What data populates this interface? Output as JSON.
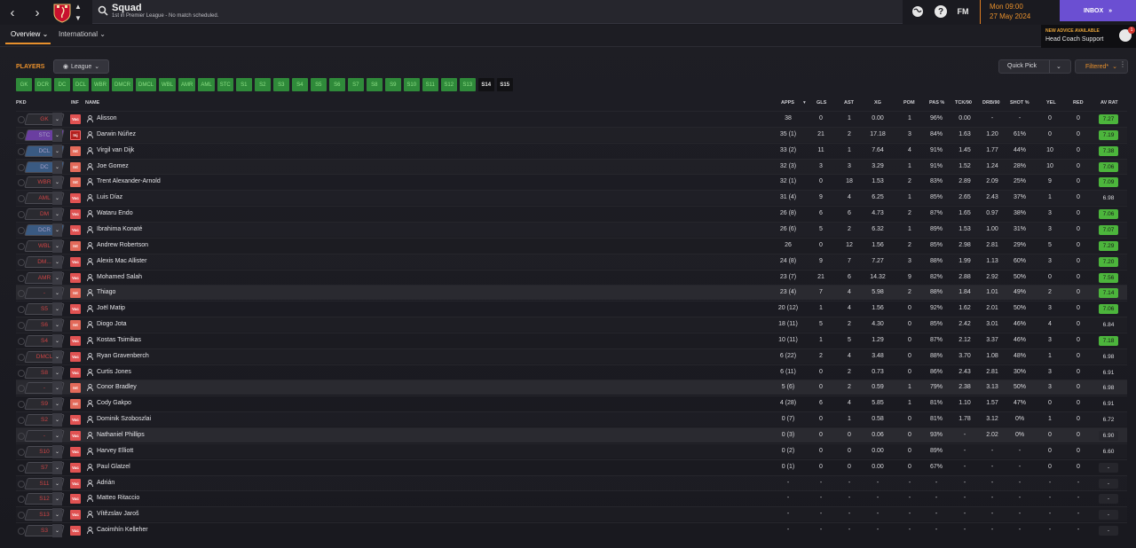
{
  "header": {
    "title": "Squad",
    "subtitle": "1st in Premier League - No match scheduled.",
    "fm_label": "FM",
    "help_label": "?",
    "date_line1": "Mon 09:00",
    "date_line2": "27 May 2024",
    "inbox_label": "INBOX"
  },
  "subnav": {
    "tabs": [
      "Overview",
      "International"
    ]
  },
  "advice": {
    "title": "NEW ADVICE AVAILABLE",
    "from": "Head Coach Support",
    "count": "1"
  },
  "toolbar": {
    "players_label": "PLAYERS",
    "league_label": "League",
    "quick_pick": "Quick Pick",
    "filtered": "Filtered*"
  },
  "position_filters": [
    "GK",
    "DCR",
    "DC",
    "DCL",
    "WBR",
    "DMCR",
    "DMCL",
    "WBL",
    "AMR",
    "AML",
    "STC",
    "S1",
    "S2",
    "S3",
    "S4",
    "S5",
    "S6",
    "S7",
    "S8",
    "S9",
    "S10",
    "S11",
    "S12",
    "S13",
    "S14",
    "S15"
  ],
  "columns": {
    "pkd": "PKD",
    "inf": "INF",
    "name": "NAME",
    "apps": "APPS",
    "gls": "GLS",
    "ast": "AST",
    "xg": "XG",
    "pom": "POM",
    "pas": "PAS %",
    "tck": "TCK/90",
    "drb": "DRB/90",
    "shot": "SHOT %",
    "yel": "YEL",
    "red": "RED",
    "avrat": "AV RAT"
  },
  "players": [
    {
      "pos": "GK",
      "status": "Vac",
      "name": "Alisson",
      "apps": "38",
      "gls": "0",
      "ast": "1",
      "xg": "0.00",
      "pom": "1",
      "pas": "96%",
      "tck": "0.00",
      "drb": "-",
      "shot": "-",
      "yel": "0",
      "red": "0",
      "rat": "7.27",
      "rat_style": "green",
      "badge": "grey"
    },
    {
      "pos": "STC",
      "status": "Inj",
      "name": "Darwin Núñez",
      "apps": "35 (1)",
      "gls": "21",
      "ast": "2",
      "xg": "17.18",
      "pom": "3",
      "pas": "84%",
      "tck": "1.63",
      "drb": "1.20",
      "shot": "61%",
      "yel": "0",
      "red": "0",
      "rat": "7.19",
      "rat_style": "green",
      "badge": "pur"
    },
    {
      "pos": "DCL",
      "status": "Int",
      "name": "Virgil van Dijk",
      "apps": "33 (2)",
      "gls": "11",
      "ast": "1",
      "xg": "7.64",
      "pom": "4",
      "pas": "91%",
      "tck": "1.45",
      "drb": "1.77",
      "shot": "44%",
      "yel": "10",
      "red": "0",
      "rat": "7.38",
      "rat_style": "green",
      "badge": "blu"
    },
    {
      "pos": "DC",
      "status": "Int",
      "name": "Joe Gomez",
      "apps": "32 (3)",
      "gls": "3",
      "ast": "3",
      "xg": "3.29",
      "pom": "1",
      "pas": "91%",
      "tck": "1.52",
      "drb": "1.24",
      "shot": "28%",
      "yel": "10",
      "red": "0",
      "rat": "7.06",
      "rat_style": "green",
      "badge": "blu"
    },
    {
      "pos": "WBR",
      "status": "Int",
      "name": "Trent Alexander-Arnold",
      "apps": "32 (1)",
      "gls": "0",
      "ast": "18",
      "xg": "1.53",
      "pom": "2",
      "pas": "83%",
      "tck": "2.89",
      "drb": "2.09",
      "shot": "25%",
      "yel": "9",
      "red": "0",
      "rat": "7.09",
      "rat_style": "green",
      "badge": "grey"
    },
    {
      "pos": "AML",
      "status": "Vac",
      "name": "Luis Díaz",
      "apps": "31 (4)",
      "gls": "9",
      "ast": "4",
      "xg": "6.25",
      "pom": "1",
      "pas": "85%",
      "tck": "2.65",
      "drb": "2.43",
      "shot": "37%",
      "yel": "1",
      "red": "0",
      "rat": "6.98",
      "rat_style": "plain",
      "badge": "grey"
    },
    {
      "pos": "DM",
      "status": "Vac",
      "name": "Wataru Endo",
      "apps": "26 (8)",
      "gls": "6",
      "ast": "6",
      "xg": "4.73",
      "pom": "2",
      "pas": "87%",
      "tck": "1.65",
      "drb": "0.97",
      "shot": "38%",
      "yel": "3",
      "red": "0",
      "rat": "7.06",
      "rat_style": "green",
      "badge": "grey"
    },
    {
      "pos": "DCR",
      "status": "Vac",
      "name": "Ibrahima Konaté",
      "apps": "26 (6)",
      "gls": "5",
      "ast": "2",
      "xg": "6.32",
      "pom": "1",
      "pas": "89%",
      "tck": "1.53",
      "drb": "1.00",
      "shot": "31%",
      "yel": "3",
      "red": "0",
      "rat": "7.07",
      "rat_style": "green",
      "badge": "blu"
    },
    {
      "pos": "WBL",
      "status": "Int",
      "name": "Andrew Robertson",
      "apps": "26",
      "gls": "0",
      "ast": "12",
      "xg": "1.56",
      "pom": "2",
      "pas": "85%",
      "tck": "2.98",
      "drb": "2.81",
      "shot": "29%",
      "yel": "5",
      "red": "0",
      "rat": "7.29",
      "rat_style": "green",
      "badge": "grey"
    },
    {
      "pos": "DM...",
      "status": "Vac",
      "name": "Alexis Mac Allister",
      "apps": "24 (8)",
      "gls": "9",
      "ast": "7",
      "xg": "7.27",
      "pom": "3",
      "pas": "88%",
      "tck": "1.99",
      "drb": "1.13",
      "shot": "60%",
      "yel": "3",
      "red": "0",
      "rat": "7.20",
      "rat_style": "green",
      "badge": "grey"
    },
    {
      "pos": "AMR",
      "status": "Vac",
      "name": "Mohamed Salah",
      "apps": "23 (7)",
      "gls": "21",
      "ast": "6",
      "xg": "14.32",
      "pom": "9",
      "pas": "82%",
      "tck": "2.88",
      "drb": "2.92",
      "shot": "50%",
      "yel": "0",
      "red": "0",
      "rat": "7.56",
      "rat_style": "green",
      "badge": "grey"
    },
    {
      "pos": "-",
      "status": "Int",
      "name": "Thiago",
      "apps": "23 (4)",
      "gls": "7",
      "ast": "4",
      "xg": "5.98",
      "pom": "2",
      "pas": "88%",
      "tck": "1.84",
      "drb": "1.01",
      "shot": "49%",
      "yel": "2",
      "red": "0",
      "rat": "7.14",
      "rat_style": "green",
      "badge": "grey",
      "hl": true
    },
    {
      "pos": "S5",
      "status": "Vac",
      "name": "Joël Matip",
      "apps": "20 (12)",
      "gls": "1",
      "ast": "4",
      "xg": "1.56",
      "pom": "0",
      "pas": "92%",
      "tck": "1.62",
      "drb": "2.01",
      "shot": "50%",
      "yel": "3",
      "red": "0",
      "rat": "7.06",
      "rat_style": "green",
      "badge": "grey"
    },
    {
      "pos": "S6",
      "status": "Int",
      "name": "Diogo Jota",
      "apps": "18 (11)",
      "gls": "5",
      "ast": "2",
      "xg": "4.30",
      "pom": "0",
      "pas": "85%",
      "tck": "2.42",
      "drb": "3.01",
      "shot": "46%",
      "yel": "4",
      "red": "0",
      "rat": "6.84",
      "rat_style": "plain",
      "badge": "grey"
    },
    {
      "pos": "S4",
      "status": "Vac",
      "name": "Kostas Tsimikas",
      "apps": "10 (11)",
      "gls": "1",
      "ast": "5",
      "xg": "1.29",
      "pom": "0",
      "pas": "87%",
      "tck": "2.12",
      "drb": "3.37",
      "shot": "46%",
      "yel": "3",
      "red": "0",
      "rat": "7.18",
      "rat_style": "green",
      "badge": "grey"
    },
    {
      "pos": "DMCL",
      "status": "Vac",
      "name": "Ryan Gravenberch",
      "apps": "6 (22)",
      "gls": "2",
      "ast": "4",
      "xg": "3.48",
      "pom": "0",
      "pas": "88%",
      "tck": "3.70",
      "drb": "1.08",
      "shot": "48%",
      "yel": "1",
      "red": "0",
      "rat": "6.98",
      "rat_style": "plain",
      "badge": "grey"
    },
    {
      "pos": "S8",
      "status": "Vac",
      "name": "Curtis Jones",
      "apps": "6 (11)",
      "gls": "0",
      "ast": "2",
      "xg": "0.73",
      "pom": "0",
      "pas": "86%",
      "tck": "2.43",
      "drb": "2.81",
      "shot": "30%",
      "yel": "3",
      "red": "0",
      "rat": "6.91",
      "rat_style": "plain",
      "badge": "grey"
    },
    {
      "pos": "-",
      "status": "Int",
      "name": "Conor Bradley",
      "apps": "5 (6)",
      "gls": "0",
      "ast": "2",
      "xg": "0.59",
      "pom": "1",
      "pas": "79%",
      "tck": "2.38",
      "drb": "3.13",
      "shot": "50%",
      "yel": "3",
      "red": "0",
      "rat": "6.98",
      "rat_style": "plain",
      "badge": "grey",
      "hl": true
    },
    {
      "pos": "S9",
      "status": "Int",
      "name": "Cody Gakpo",
      "apps": "4 (28)",
      "gls": "6",
      "ast": "4",
      "xg": "5.85",
      "pom": "1",
      "pas": "81%",
      "tck": "1.10",
      "drb": "1.57",
      "shot": "47%",
      "yel": "0",
      "red": "0",
      "rat": "6.91",
      "rat_style": "plain",
      "badge": "grey"
    },
    {
      "pos": "S2",
      "status": "Vac",
      "name": "Dominik Szoboszlai",
      "apps": "0 (7)",
      "gls": "0",
      "ast": "1",
      "xg": "0.58",
      "pom": "0",
      "pas": "81%",
      "tck": "1.78",
      "drb": "3.12",
      "shot": "0%",
      "yel": "1",
      "red": "0",
      "rat": "6.72",
      "rat_style": "plain",
      "badge": "grey"
    },
    {
      "pos": "-",
      "status": "Vac",
      "name": "Nathaniel Phillips",
      "apps": "0 (3)",
      "gls": "0",
      "ast": "0",
      "xg": "0.06",
      "pom": "0",
      "pas": "93%",
      "tck": "-",
      "drb": "2.02",
      "shot": "0%",
      "yel": "0",
      "red": "0",
      "rat": "6.90",
      "rat_style": "dim",
      "badge": "grey",
      "hl": true
    },
    {
      "pos": "S10",
      "status": "Vac",
      "name": "Harvey Elliott",
      "apps": "0 (2)",
      "gls": "0",
      "ast": "0",
      "xg": "0.00",
      "pom": "0",
      "pas": "89%",
      "tck": "-",
      "drb": "-",
      "shot": "-",
      "yel": "0",
      "red": "0",
      "rat": "6.60",
      "rat_style": "plain",
      "badge": "grey"
    },
    {
      "pos": "S7",
      "status": "Vac",
      "name": "Paul Glatzel",
      "apps": "0 (1)",
      "gls": "0",
      "ast": "0",
      "xg": "0.00",
      "pom": "0",
      "pas": "67%",
      "tck": "-",
      "drb": "-",
      "shot": "-",
      "yel": "0",
      "red": "0",
      "rat": "-",
      "rat_style": "dim",
      "badge": "grey"
    },
    {
      "pos": "S11",
      "status": "Vac",
      "name": "Adrián",
      "apps": "-",
      "gls": "-",
      "ast": "-",
      "xg": "-",
      "pom": "-",
      "pas": "-",
      "tck": "-",
      "drb": "-",
      "shot": "-",
      "yel": "-",
      "red": "-",
      "rat": "-",
      "rat_style": "dim",
      "badge": "grey"
    },
    {
      "pos": "S12",
      "status": "Vac",
      "name": "Matteo Ritaccio",
      "apps": "-",
      "gls": "-",
      "ast": "-",
      "xg": "-",
      "pom": "-",
      "pas": "-",
      "tck": "-",
      "drb": "-",
      "shot": "-",
      "yel": "-",
      "red": "-",
      "rat": "-",
      "rat_style": "dim",
      "badge": "grey"
    },
    {
      "pos": "S13",
      "status": "Vac",
      "name": "Vítězslav Jaroš",
      "apps": "-",
      "gls": "-",
      "ast": "-",
      "xg": "-",
      "pom": "-",
      "pas": "-",
      "tck": "-",
      "drb": "-",
      "shot": "-",
      "yel": "-",
      "red": "-",
      "rat": "-",
      "rat_style": "dim",
      "badge": "grey"
    },
    {
      "pos": "S3",
      "status": "Vac",
      "name": "Caoimhín Kelleher",
      "apps": "-",
      "gls": "-",
      "ast": "-",
      "xg": "-",
      "pom": "-",
      "pas": "-",
      "tck": "-",
      "drb": "-",
      "shot": "-",
      "yel": "-",
      "red": "-",
      "rat": "-",
      "rat_style": "dim",
      "badge": "grey"
    }
  ],
  "colors": {
    "accent": "#e8902c",
    "inbox": "#6b4fd2",
    "rating_green": "#4cb53c",
    "vac": "#e05252"
  }
}
